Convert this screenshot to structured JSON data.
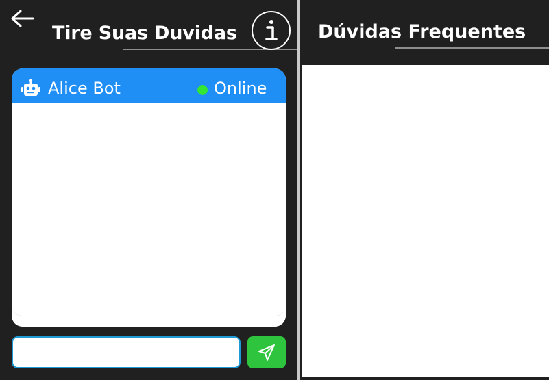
{
  "chat_section": {
    "title": "Tire Suas Duvidas",
    "back_icon": "arrow-left-icon",
    "info_icon": "info-icon",
    "header": {
      "bot_icon": "robot-icon",
      "bot_name": "Alice Bot",
      "status": "Online",
      "status_color": "#33e633",
      "header_color": "#1f8ff6"
    },
    "messages": [],
    "input": {
      "value": "",
      "placeholder": ""
    },
    "send_icon": "send-icon",
    "send_color": "#2ec43d"
  },
  "faq_section": {
    "title": "Dúvidas Frequentes",
    "items": []
  },
  "colors": {
    "background": "#202020",
    "divider": "#c9c9c9",
    "underline": "#8e8e8e"
  }
}
